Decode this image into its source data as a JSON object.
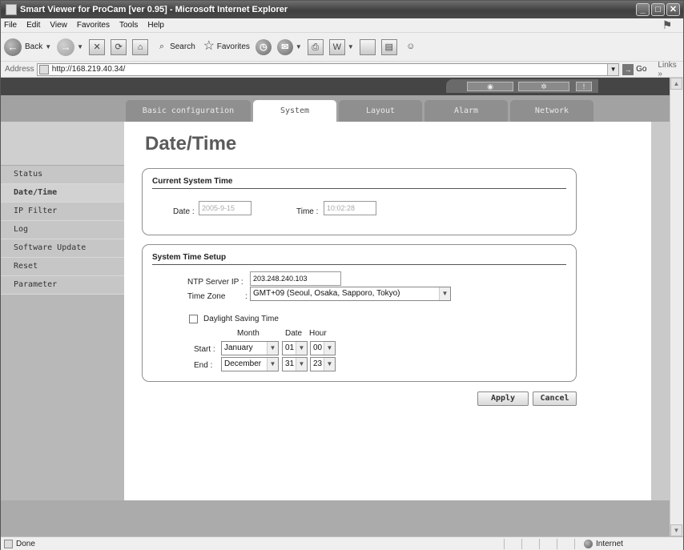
{
  "window": {
    "title": "Smart Viewer for ProCam [ver 0.95] - Microsoft Internet Explorer"
  },
  "menu": [
    "File",
    "Edit",
    "View",
    "Favorites",
    "Tools",
    "Help"
  ],
  "toolbar": {
    "back": "Back",
    "search": "Search",
    "favorites": "Favorites"
  },
  "address": {
    "label": "Address",
    "url": "http://168.219.40.34/",
    "go": "Go",
    "links": "Links"
  },
  "tabs": [
    "Basic configuration",
    "System",
    "Layout",
    "Alarm",
    "Network"
  ],
  "sidebar": [
    "Status",
    "Date/Time",
    "IP Filter",
    "Log",
    "Software Update",
    "Reset",
    "Parameter"
  ],
  "page": {
    "title": "Date/Time"
  },
  "current_time": {
    "title": "Current System Time",
    "date_label": "Date :",
    "date_value": "2005-9-15",
    "time_label": "Time :",
    "time_value": "10:02:28"
  },
  "setup": {
    "title": "System Time Setup",
    "ntp_label": "NTP Server IP :",
    "ntp_value": "203.248.240.103",
    "tz_label": "Time Zone",
    "tz_colon": ":",
    "tz_value": "GMT+09 (Seoul, Osaka, Sapporo, Tokyo)",
    "dst_label": "Daylight Saving Time",
    "col_month": "Month",
    "col_date": "Date",
    "col_hour": "Hour",
    "start_label": "Start :",
    "start_month": "January",
    "start_date": "01",
    "start_hour": "00",
    "end_label": "End :",
    "end_month": "December",
    "end_date": "31",
    "end_hour": "23"
  },
  "buttons": {
    "apply": "Apply",
    "cancel": "Cancel"
  },
  "status": {
    "left": "Done",
    "zone": "Internet"
  }
}
